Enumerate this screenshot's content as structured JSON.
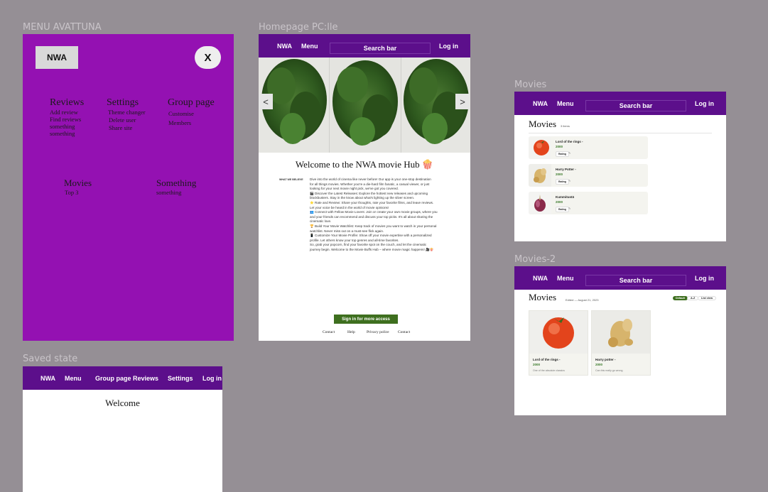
{
  "frames": {
    "menu_label": "MENU AVATTUNA",
    "home_label": "Homepage PC:lle",
    "movies_label": "Movies",
    "movies2_label": "Movies-2",
    "saved_label": "Saved state"
  },
  "menu": {
    "logo": "NWA",
    "close": "X",
    "columns": [
      {
        "title": "Reviews",
        "items": [
          "Add review",
          "Find reviews",
          "something",
          "something"
        ]
      },
      {
        "title": "Settings",
        "items": [
          "Theme changer",
          "Delete user",
          "Share site"
        ]
      },
      {
        "title": "Group page",
        "items": [
          "Customise",
          "Members"
        ]
      }
    ],
    "lower": [
      {
        "title": "Movies",
        "items": [
          "Top 3"
        ]
      },
      {
        "title": "Something",
        "items": [
          "something"
        ]
      }
    ]
  },
  "nav": {
    "brand": "NWA",
    "menu": "Menu",
    "search": "Search bar",
    "login": "Log in"
  },
  "home": {
    "arrow_left": "<",
    "arrow_right": ">",
    "title": "Welcome to the NWA movie Hub 🍿",
    "side_label": "WHAT WE BELIEVE",
    "body_lines": [
      "Dive into the world of cinema like never before! Our app is your one-stop destination",
      "for all things movies. Whether you're a die-hard film fanatic, a casual viewer, or just",
      "looking for your next movie night pick, we've got you covered.",
      "🎬 Discover the Latest Releases: Explore the hottest new releases and upcoming",
      "blockbusters. Stay in the know about what's lighting up the silver screen.",
      "⭐ Rate and Review: Share your thoughts, rate your favorite films, and leave reviews.",
      "Let your voice be heard in the world of movie opinions!",
      "👥 Connect with Fellow Movie Lovers: Join or create your own movie groups, where you",
      "and your friends can recommend and discuss your top picks. It's all about sharing the",
      "cinematic love.",
      "🏆 Build Your Movie Watchlist: Keep track of movies you want to watch in your personal",
      "watchlist. Never miss out on a must-see flick again.",
      "📱 Customize Your Movie Profile: Show off your movie expertise with a personalized",
      "profile. Let others know your top genres and all-time favorites.",
      "So, grab your popcorn, find your favorite spot on the couch, and let the cinematic",
      "journey begin. Welcome to the Movie Buffs Hub – where movie magic happens! 🎥🍿"
    ],
    "cta": "Sign in for more access",
    "footer": [
      "Contact",
      "Help",
      "Privacy police",
      "Contact"
    ]
  },
  "movies": {
    "title": "Movies",
    "count": "3 items",
    "items": [
      {
        "title": "Lord of the rings -",
        "year": "2000",
        "rating": "Rating"
      },
      {
        "title": "Harry Potter -",
        "year": "2000",
        "rating": "Rating"
      },
      {
        "title": "Kummitustä",
        "year": "2000",
        "rating": "Rating"
      }
    ]
  },
  "movies2": {
    "title": "Movies",
    "edited": "Edited —  August 21, 2023",
    "filters": [
      "Default",
      "A-Z",
      "List view"
    ],
    "cards": [
      {
        "title": "Lord of the rings -",
        "year": "2000",
        "desc": "One of the absolute classics"
      },
      {
        "title": "Harry potter -",
        "year": "2000",
        "desc": "Can this really go wrong"
      }
    ]
  },
  "saved": {
    "nav": [
      "NWA",
      "Menu",
      "Group page",
      "Reviews",
      "Settings",
      "Log in"
    ],
    "welcome": "Welcome"
  },
  "colors": {
    "nav_purple": "#5c0f8b",
    "menu_purple": "#9411b2",
    "cta_green": "#3e6f1f",
    "canvas": "#958f95"
  }
}
